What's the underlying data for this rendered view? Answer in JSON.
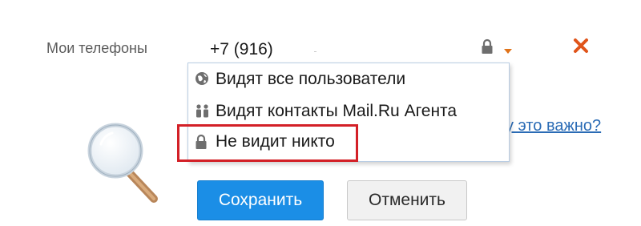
{
  "phones_label": "Мои телефоны",
  "phone": {
    "value": "+7 (916)"
  },
  "privacy_menu": {
    "items": [
      {
        "label": "Видят все пользователи",
        "icon": "globe-icon"
      },
      {
        "label": "Видят контакты Mail.Ru Агента",
        "icon": "contacts-icon"
      },
      {
        "label": "Не видит никто",
        "icon": "lock-icon",
        "highlighted": true
      }
    ]
  },
  "why_link": "у это важно?",
  "buttons": {
    "save": "Сохранить",
    "cancel": "Отменить"
  },
  "colors": {
    "save_bg": "#1b8ee6",
    "link": "#2a6bb5",
    "remove": "#e0541a",
    "caret": "#e0731a",
    "highlight": "#d32027"
  }
}
